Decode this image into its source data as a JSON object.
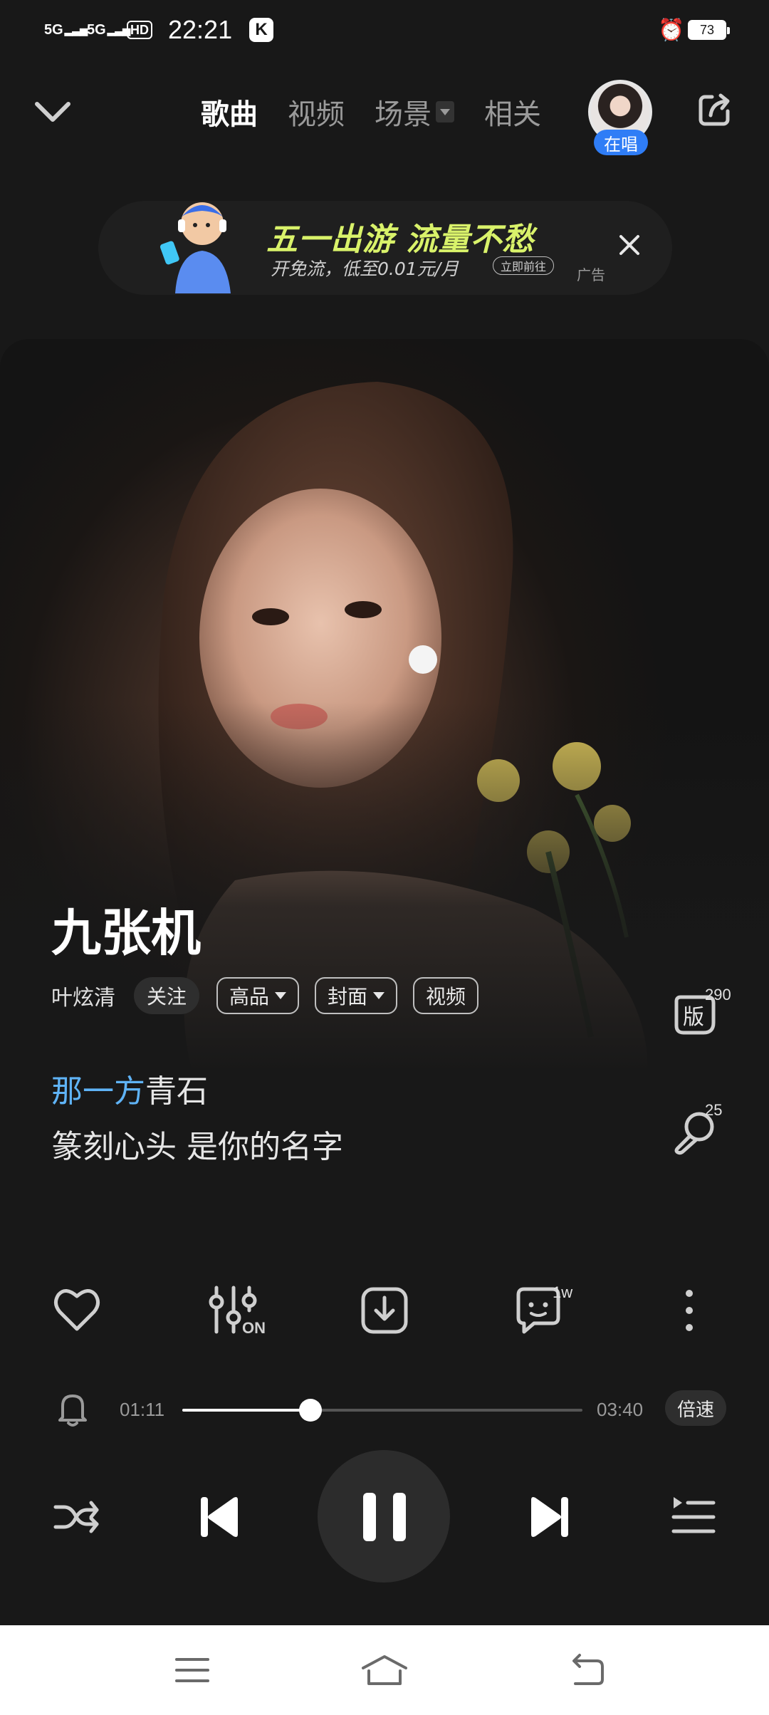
{
  "status_bar": {
    "network1": "5G",
    "network2": "5G",
    "hd": "HD",
    "time": "22:21",
    "app_icon": "K",
    "battery": "73"
  },
  "nav": {
    "tabs": [
      "歌曲",
      "视频",
      "场景",
      "相关"
    ],
    "active_tab": "歌曲",
    "singing_badge": "在唱"
  },
  "ad": {
    "headline": "五一出游 流量不愁",
    "subtext": "开免流，低至0.01元/月",
    "button": "立即前往",
    "tag": "广告"
  },
  "song": {
    "title": "九张机",
    "artist": "叶炫清",
    "follow": "关注",
    "chips": [
      "高品",
      "封面",
      "视频"
    ],
    "version_icon_label": "版",
    "version_count": "290",
    "comment_count": "25"
  },
  "lyrics": {
    "line1_highlight": "那一方",
    "line1_rest": "青石",
    "line2": "篆刻心头 是你的名字"
  },
  "actions": {
    "comment_badge": "1w"
  },
  "progress": {
    "current": "01:11",
    "total": "03:40",
    "played_fraction": 0.32,
    "speed_label": "倍速"
  },
  "colors": {
    "background": "#181818",
    "lyric_highlight": "#5fb3f6",
    "singing_badge": "#2f7df6",
    "ad_headline": "#d9f26a"
  }
}
